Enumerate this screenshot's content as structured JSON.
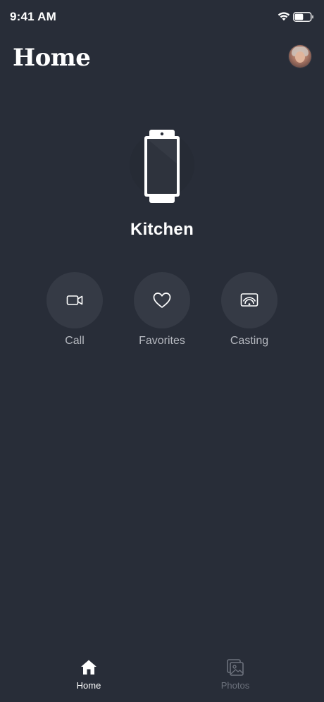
{
  "status_bar": {
    "time": "9:41 AM",
    "wifi_icon": "wifi-icon",
    "battery_icon": "battery-icon",
    "battery_level": 0.55
  },
  "header": {
    "title": "Home",
    "avatar_icon": "avatar"
  },
  "device": {
    "icon": "smart-display-icon",
    "name": "Kitchen"
  },
  "actions": [
    {
      "label": "Call",
      "icon": "video-camera-icon"
    },
    {
      "label": "Favorites",
      "icon": "heart-icon"
    },
    {
      "label": "Casting",
      "icon": "cast-icon"
    }
  ],
  "tab_bar": {
    "tabs": [
      {
        "label": "Home",
        "icon": "home-icon",
        "active": true
      },
      {
        "label": "Photos",
        "icon": "photos-icon",
        "active": false
      }
    ]
  },
  "colors": {
    "background": "#282d38",
    "action_circle": "#353a45",
    "label_muted": "#b5b8bf",
    "tab_inactive": "#6c717c"
  }
}
